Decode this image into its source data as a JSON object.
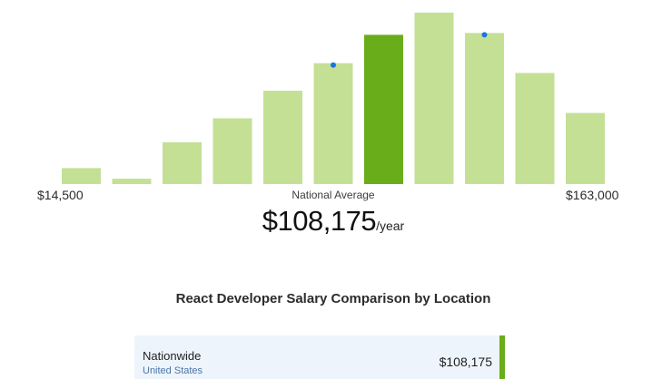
{
  "chart_data": {
    "type": "bar",
    "title": "",
    "xlabel": "",
    "ylabel": "",
    "min_label": "$14,500",
    "max_label": "$163,000",
    "values": [
      18,
      6,
      47,
      74,
      105,
      136,
      168,
      193,
      170,
      125,
      80
    ],
    "highlight_index": 6,
    "dot_indices": [
      5,
      8
    ],
    "ylim": [
      0,
      200
    ],
    "grid": false
  },
  "colors": {
    "bar": "#c3e095",
    "bar_highlight": "#6aad1a",
    "dot": "#1a73e8",
    "row_bg": "#eef4fb",
    "row_accent": "#6aad1a"
  },
  "average": {
    "caption": "National Average",
    "value": "$108,175",
    "unit": "/year"
  },
  "comparison": {
    "title": "React Developer Salary Comparison by Location",
    "rows": [
      {
        "name": "Nationwide",
        "sub": "United States",
        "salary": "$108,175"
      }
    ]
  }
}
